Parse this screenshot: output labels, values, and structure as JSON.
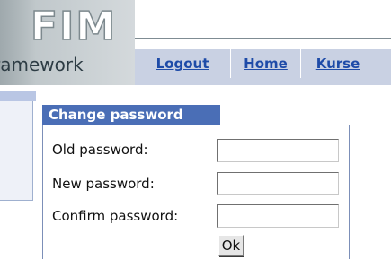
{
  "branding": {
    "logo": "FIM",
    "subtitle": "ramework"
  },
  "nav": {
    "items": [
      {
        "label": "Logout"
      },
      {
        "label": "Home"
      },
      {
        "label": "Kurse"
      }
    ]
  },
  "change_password": {
    "title": "Change password",
    "fields": [
      {
        "label": "Old password:",
        "value": ""
      },
      {
        "label": "New password:",
        "value": ""
      },
      {
        "label": "Confirm password:",
        "value": ""
      }
    ],
    "submit_label": "Ok"
  },
  "colors": {
    "nav_background": "#c9d1e3",
    "nav_link": "#1e4ba8",
    "panel_title_background": "#4a6eb6",
    "panel_title_text": "#ffffff"
  }
}
